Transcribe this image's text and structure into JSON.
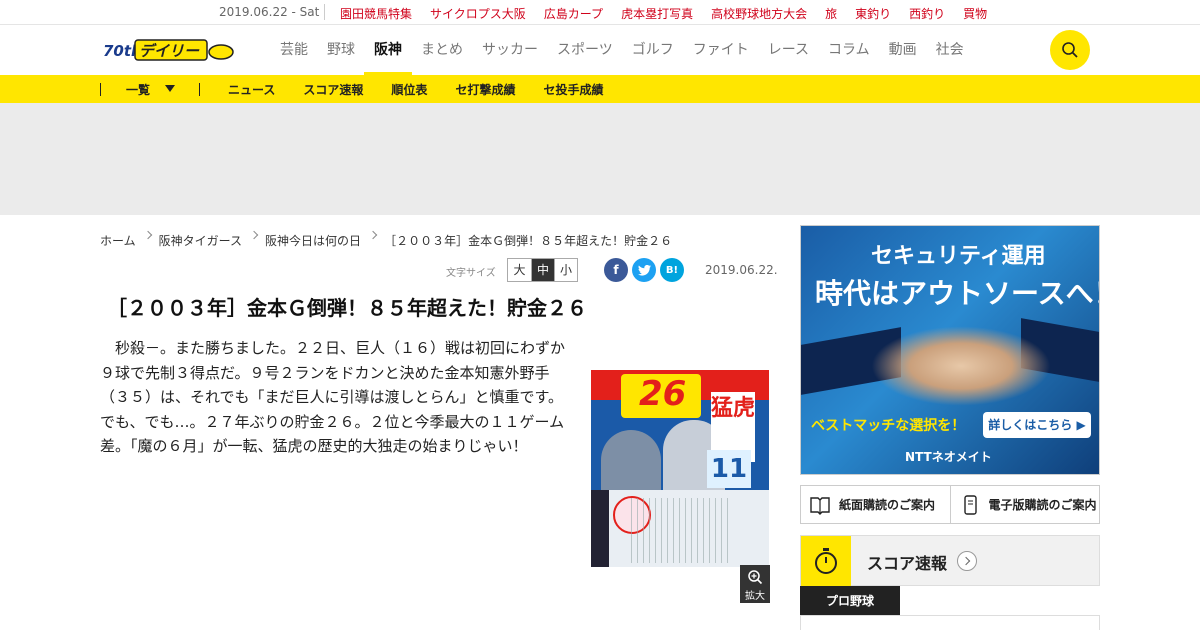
{
  "topbar": {
    "date": "2019.06.22 - Sat",
    "links": [
      "園田競馬特集",
      "サイクロプス大阪",
      "広島カープ",
      "虎本塁打写真",
      "高校野球地方大会",
      "旅",
      "東釣り",
      "西釣り",
      "買物"
    ]
  },
  "header": {
    "logo_text": "デイリー",
    "logo_badge": "70th",
    "nav": [
      "芸能",
      "野球",
      "阪神",
      "まとめ",
      "サッカー",
      "スポーツ",
      "ゴルフ",
      "ファイト",
      "レース",
      "コラム",
      "動画",
      "社会"
    ],
    "active_nav": "阪神"
  },
  "subnav": {
    "all_label": "一覧",
    "links": [
      "ニュース",
      "スコア速報",
      "順位表",
      "セ打撃成績",
      "セ投手成績"
    ]
  },
  "breadcrumb": [
    "ホーム",
    "阪神タイガース",
    "阪神今日は何の日",
    "［２００３年］金本Ｇ倒弾！８５年超えた！貯金２６"
  ],
  "tools": {
    "font_size_label": "文字サイズ",
    "sizes": [
      "大",
      "中",
      "小"
    ],
    "selected_size": "中",
    "share": {
      "fb": "f",
      "tw": "t",
      "hb": "B!"
    },
    "date": "2019.06.22."
  },
  "article": {
    "title": "［２００３年］金本Ｇ倒弾！８５年超えた！貯金２６",
    "body": "秒殺－。また勝ちました。２２日、巨人（１６）戦は初回にわずか９球で先制３得点だ。９号２ランをドカンと決めた金本知憲外野手（３５）は、それでも「まだ巨人に引導は渡しとらん」と慎重です。でも、でも…。２７年ぶりの貯金２６。２位と今季最大の１１ゲーム差。「魔の６月」が一転、猛虎の歴史的大独走の始まりじゃい！",
    "paper": {
      "n26": "26",
      "tora": "猛虎",
      "n11": "11"
    },
    "zoom_label": "拡大"
  },
  "ad": {
    "line1": "セキュリティ運用",
    "line2": "時代はアウトソースへ！",
    "line3": "ベストマッチな選択を！",
    "cta": "詳しくはこちら ▶",
    "brand": "NTTネオメイト"
  },
  "sidebar": {
    "paper_sub": "紙面購読のご案内",
    "digital_sub": "電子版購読のご案内",
    "score_title": "スコア速報",
    "tab": "プロ野球"
  },
  "colors": {
    "brand_yellow": "#ffe600",
    "link_red": "#d0021b"
  }
}
